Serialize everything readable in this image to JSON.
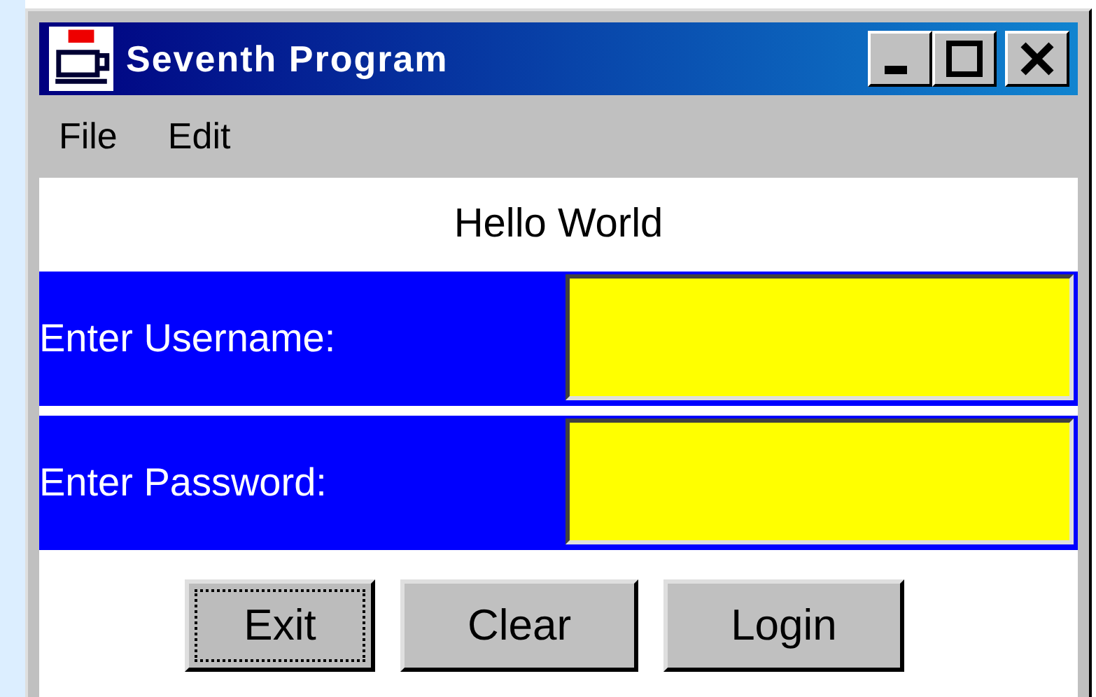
{
  "window": {
    "title": "Seventh Program"
  },
  "menu": [
    {
      "label": "File"
    },
    {
      "label": "Edit"
    }
  ],
  "greeting": "Hello World",
  "fields": [
    {
      "label": "Enter Username:"
    },
    {
      "label": "Enter Password:"
    }
  ],
  "buttons": [
    {
      "label": "Exit",
      "focused": true
    },
    {
      "label": "Clear",
      "focused": false
    },
    {
      "label": "Login",
      "focused": false
    }
  ]
}
